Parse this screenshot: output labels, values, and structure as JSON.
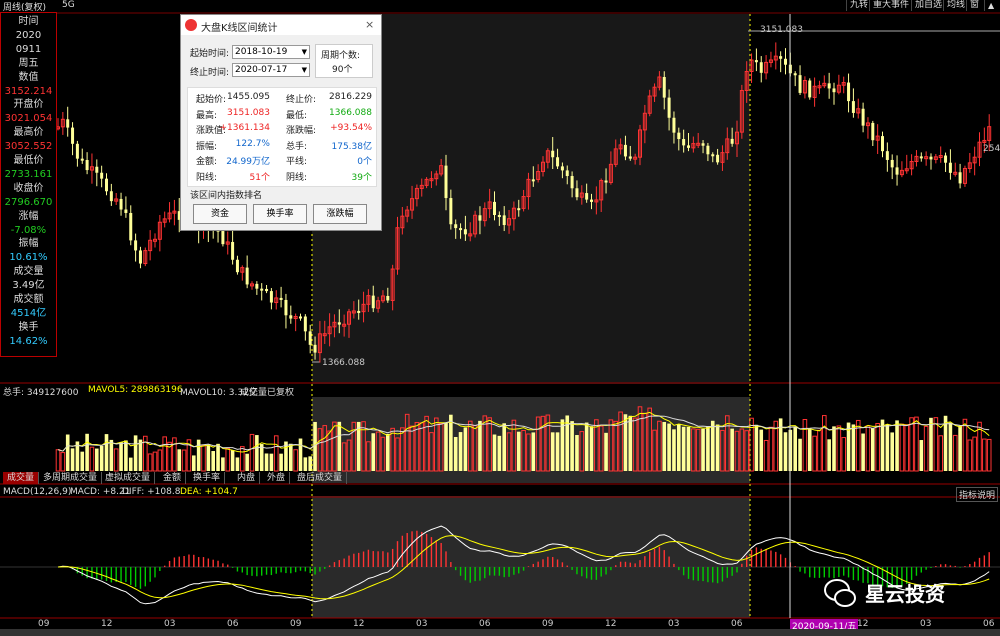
{
  "topbar": {
    "period": "周线(复权)",
    "net": "5G",
    "buttons": [
      "九转",
      "重大事件",
      "加自选",
      "均线",
      "窗"
    ]
  },
  "info": {
    "rows": [
      {
        "label": "时间"
      },
      {
        "value": "2020",
        "cls": "w"
      },
      {
        "value": "0911",
        "cls": "w"
      },
      {
        "label": "周五"
      },
      {
        "label": "数值"
      },
      {
        "value": "3152.214",
        "cls": "r"
      },
      {
        "label": "开盘价"
      },
      {
        "value": "3021.054",
        "cls": "r"
      },
      {
        "label": "最高价"
      },
      {
        "value": "3052.552",
        "cls": "r"
      },
      {
        "label": "最低价"
      },
      {
        "value": "2733.161",
        "cls": "g"
      },
      {
        "label": "收盘价"
      },
      {
        "value": "2796.670",
        "cls": "g"
      },
      {
        "label": "涨幅"
      },
      {
        "value": "-7.08%",
        "cls": "g"
      },
      {
        "label": "振幅"
      },
      {
        "value": "10.61%",
        "cls": "c"
      },
      {
        "label": "成交量"
      },
      {
        "value": "3.49亿",
        "cls": "w"
      },
      {
        "label": "成交额"
      },
      {
        "value": "4514亿",
        "cls": "c"
      },
      {
        "label": "换手"
      },
      {
        "value": "14.62%",
        "cls": "c"
      }
    ]
  },
  "price_labels": {
    "high": "3151.083",
    "low": "1366.088",
    "right_edge": "254"
  },
  "dialog": {
    "title": "大盘K线区间统计",
    "start_label": "起始时间:",
    "start_date": "2018-10-19",
    "end_label": "终止时间:",
    "end_date": "2020-07-17",
    "period_label": "周期个数:",
    "period_count": "90个",
    "stats": [
      {
        "l": "起始价:",
        "v": "1455.095",
        "vc": "#222",
        "l2": "终止价:",
        "v2": "2816.229",
        "v2c": "#222"
      },
      {
        "l": "最高:",
        "v": "3151.083",
        "vc": "#e22",
        "l2": "最低:",
        "v2": "1366.088",
        "v2c": "#1a1"
      },
      {
        "l": "涨跌值:",
        "v": "+1361.134",
        "vc": "#e22",
        "l2": "涨跌幅:",
        "v2": "+93.54%",
        "v2c": "#e22"
      },
      {
        "l": "振幅:",
        "v": "122.7%",
        "vc": "#16c",
        "l2": "总手:",
        "v2": "175.38亿",
        "v2c": "#16c"
      },
      {
        "l": "金额:",
        "v": "24.99万亿",
        "vc": "#16c",
        "l2": "平线:",
        "v2": "0个",
        "v2c": "#16c"
      },
      {
        "l": "阳线:",
        "v": "51个",
        "vc": "#e22",
        "l2": "阴线:",
        "v2": "39个",
        "v2c": "#1a1"
      }
    ],
    "rank_label": "该区间内指数排名",
    "btn_funds": "资金",
    "btn_turnover": "换手率",
    "btn_change": "涨跌幅"
  },
  "volume": {
    "header_total": "总手: 349127600",
    "mavol5": "MAVOL5: 289863196",
    "mavol10": "MAVOL10: 3.32亿",
    "note": "成交量已复权",
    "tabs": [
      "成交量",
      "多周期成交量",
      "虚拟成交量",
      "金额",
      "换手率",
      "内盘",
      "外盘",
      "盘后成交量"
    ]
  },
  "macd": {
    "name": "MACD(12,26,9)",
    "macd": "MACD: +8.21",
    "diff": "DIFF: +108.8",
    "dea": "DEA: +104.7",
    "help": "指标说明"
  },
  "xaxis": {
    "labels": [
      "09",
      "12",
      "03",
      "06",
      "09",
      "12",
      "03",
      "06",
      "09",
      "12",
      "03",
      "06",
      "09",
      "12",
      "03",
      "06"
    ],
    "cursor_date": "2020-09-11/五"
  },
  "watermark": {
    "text": "星云投资"
  },
  "colors": {
    "up": "#ff3333",
    "down": "#ffff99",
    "bg": "#000000",
    "dif": "#ffffff",
    "dea": "#ffff00",
    "mavol10": "#aa55ff"
  }
}
